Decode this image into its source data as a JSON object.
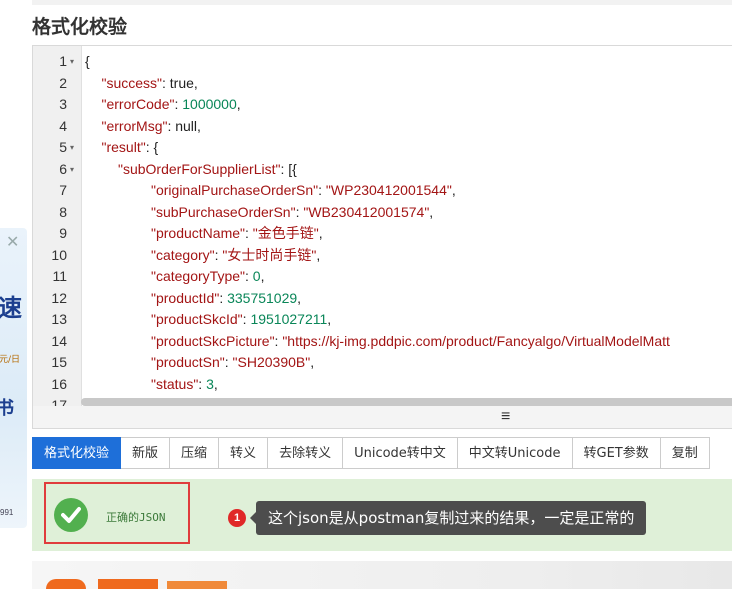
{
  "section_title": "格式化校验",
  "editor": {
    "lines": [
      {
        "n": "1",
        "fold": true,
        "indent": 0,
        "parts": [
          [
            "p",
            "{"
          ]
        ]
      },
      {
        "n": "2",
        "fold": false,
        "indent": 1,
        "parts": [
          [
            "k",
            "\"success\""
          ],
          [
            "p",
            ": true,"
          ]
        ]
      },
      {
        "n": "3",
        "fold": false,
        "indent": 1,
        "parts": [
          [
            "k",
            "\"errorCode\""
          ],
          [
            "p",
            ": "
          ],
          [
            "n",
            "1000000"
          ],
          [
            "p",
            ","
          ]
        ]
      },
      {
        "n": "4",
        "fold": false,
        "indent": 1,
        "parts": [
          [
            "k",
            "\"errorMsg\""
          ],
          [
            "p",
            ": null,"
          ]
        ]
      },
      {
        "n": "5",
        "fold": true,
        "indent": 1,
        "parts": [
          [
            "k",
            "\"result\""
          ],
          [
            "p",
            ": {"
          ]
        ]
      },
      {
        "n": "6",
        "fold": true,
        "indent": 2,
        "parts": [
          [
            "k",
            "\"subOrderForSupplierList\""
          ],
          [
            "p",
            ": [{"
          ]
        ]
      },
      {
        "n": "7",
        "fold": false,
        "indent": 4,
        "parts": [
          [
            "k",
            "\"originalPurchaseOrderSn\""
          ],
          [
            "p",
            ": "
          ],
          [
            "s",
            "\"WP230412001544\""
          ],
          [
            "p",
            ","
          ]
        ]
      },
      {
        "n": "8",
        "fold": false,
        "indent": 4,
        "parts": [
          [
            "k",
            "\"subPurchaseOrderSn\""
          ],
          [
            "p",
            ": "
          ],
          [
            "s",
            "\"WB230412001574\""
          ],
          [
            "p",
            ","
          ]
        ]
      },
      {
        "n": "9",
        "fold": false,
        "indent": 4,
        "parts": [
          [
            "k",
            "\"productName\""
          ],
          [
            "p",
            ": "
          ],
          [
            "s",
            "\"金色手链\""
          ],
          [
            "p",
            ","
          ]
        ]
      },
      {
        "n": "10",
        "fold": false,
        "indent": 4,
        "parts": [
          [
            "k",
            "\"category\""
          ],
          [
            "p",
            ": "
          ],
          [
            "s",
            "\"女士时尚手链\""
          ],
          [
            "p",
            ","
          ]
        ]
      },
      {
        "n": "11",
        "fold": false,
        "indent": 4,
        "parts": [
          [
            "k",
            "\"categoryType\""
          ],
          [
            "p",
            ": "
          ],
          [
            "n",
            "0"
          ],
          [
            "p",
            ","
          ]
        ]
      },
      {
        "n": "12",
        "fold": false,
        "indent": 4,
        "parts": [
          [
            "k",
            "\"productId\""
          ],
          [
            "p",
            ": "
          ],
          [
            "n",
            "335751029"
          ],
          [
            "p",
            ","
          ]
        ]
      },
      {
        "n": "13",
        "fold": false,
        "indent": 4,
        "parts": [
          [
            "k",
            "\"productSkcId\""
          ],
          [
            "p",
            ": "
          ],
          [
            "n",
            "1951027211"
          ],
          [
            "p",
            ","
          ]
        ]
      },
      {
        "n": "14",
        "fold": false,
        "indent": 4,
        "parts": [
          [
            "k",
            "\"productSkcPicture\""
          ],
          [
            "p",
            ": "
          ],
          [
            "s",
            "\"https://kj-img.pddpic.com/product/Fancyalgo/VirtualModelMatt"
          ]
        ]
      },
      {
        "n": "15",
        "fold": false,
        "indent": 4,
        "parts": [
          [
            "k",
            "\"productSn\""
          ],
          [
            "p",
            ": "
          ],
          [
            "s",
            "\"SH20390B\""
          ],
          [
            "p",
            ","
          ]
        ]
      },
      {
        "n": "16",
        "fold": false,
        "indent": 4,
        "parts": [
          [
            "k",
            "\"status\""
          ],
          [
            "p",
            ": "
          ],
          [
            "n",
            "3"
          ],
          [
            "p",
            ","
          ]
        ]
      },
      {
        "n": "17",
        "fold": false,
        "indent": 4,
        "parts": [
          [
            "k",
            "\"fulfilmentFormId\""
          ],
          [
            "p",
            ": null"
          ]
        ]
      }
    ]
  },
  "toolbar": {
    "buttons": [
      {
        "label": "格式化校验",
        "name": "format-validate-button",
        "active": true
      },
      {
        "label": "新版",
        "name": "new-version-button",
        "active": false
      },
      {
        "label": "压缩",
        "name": "compress-button",
        "active": false
      },
      {
        "label": "转义",
        "name": "escape-button",
        "active": false
      },
      {
        "label": "去除转义",
        "name": "unescape-button",
        "active": false
      },
      {
        "label": "Unicode转中文",
        "name": "unicode-to-chinese-button",
        "active": false
      },
      {
        "label": "中文转Unicode",
        "name": "chinese-to-unicode-button",
        "active": false
      },
      {
        "label": "转GET参数",
        "name": "to-get-params-button",
        "active": false
      },
      {
        "label": "复制",
        "name": "copy-button",
        "active": false
      }
    ]
  },
  "result": {
    "text": "正确的JSON"
  },
  "annotation": {
    "badge": "1",
    "text": "这个json是从postman复制过来的结果，一定是正常的"
  },
  "side_ad": {
    "big1": "速",
    "small1": "元/日",
    "big2": "书",
    "small2": "991"
  },
  "colors": {
    "accent": "#1e6fd9",
    "success_bg": "#dff0d8",
    "success_icon": "#52b04f",
    "highlight_border": "#e03c3c"
  }
}
